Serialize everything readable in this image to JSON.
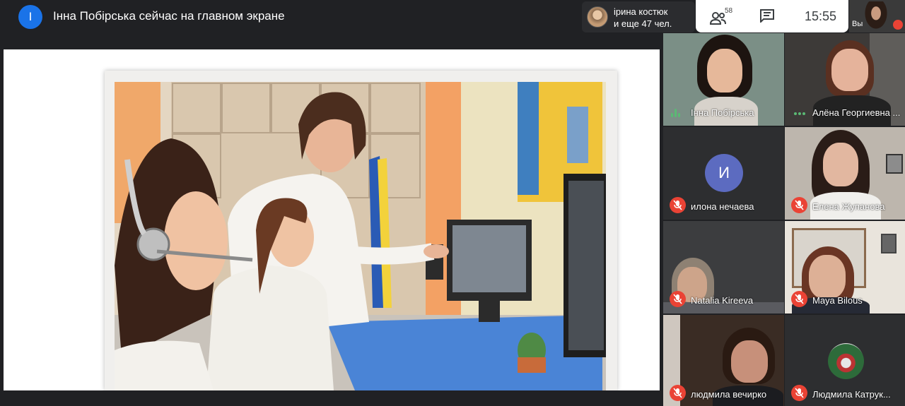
{
  "presenter": {
    "avatar_letter": "І",
    "banner": "Інна Побірська сейчас на главном экране"
  },
  "viewers": {
    "line1": "ірина костюк",
    "line2": "и еще 47 чел."
  },
  "toolbar": {
    "people_count": "58",
    "time": "15:55"
  },
  "self_tile": {
    "label": "Вы"
  },
  "participants": [
    {
      "name": "Інна Побірська",
      "status": "speaking"
    },
    {
      "name": "Алёна Георгиевна ...",
      "status": "active"
    },
    {
      "name": "илона нечаева",
      "status": "muted",
      "avatar_letter": "И"
    },
    {
      "name": "Елена Жупанова",
      "status": "muted"
    },
    {
      "name": "Natalia Kireeva",
      "status": "muted"
    },
    {
      "name": "Maya Bilous",
      "status": "muted"
    },
    {
      "name": "людмила вечирко",
      "status": "muted"
    },
    {
      "name": "Людмила Катрук...",
      "status": "muted"
    }
  ],
  "colors": {
    "background": "#202124",
    "accent_blue": "#1a73e8",
    "mic_muted": "#ea4335",
    "speaking_green": "#5bb974",
    "avatar_purple": "#5c6bc0"
  },
  "icons": {
    "people": "people-icon",
    "chat": "chat-icon",
    "mic_off": "mic-off-icon"
  }
}
